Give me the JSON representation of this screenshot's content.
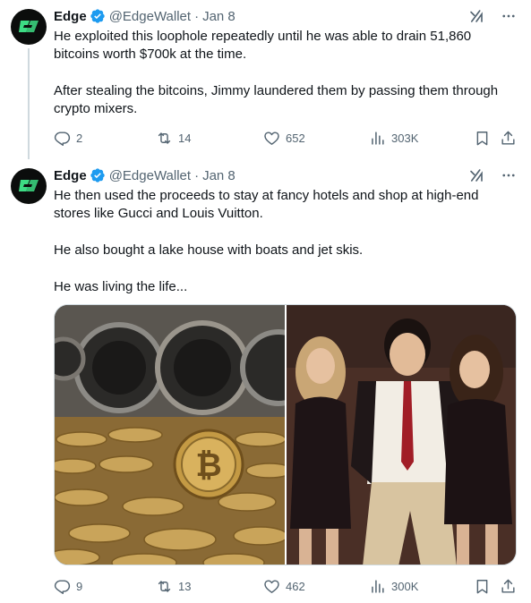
{
  "tweets": [
    {
      "author": {
        "name": "Edge",
        "handle": "@EdgeWallet",
        "date": "Jan 8"
      },
      "paragraphs": [
        "He exploited this loophole repeatedly until he was able to drain 51,860 bitcoins worth $700k at the time.",
        "After stealing the bitcoins, Jimmy laundered them by passing them through crypto mixers."
      ],
      "stats": {
        "replies": "2",
        "reposts": "14",
        "likes": "652",
        "views": "303K"
      }
    },
    {
      "author": {
        "name": "Edge",
        "handle": "@EdgeWallet",
        "date": "Jan 8"
      },
      "paragraphs": [
        "He then used the proceeds to stay at fancy hotels and shop at high-end stores like Gucci and Louis Vuitton.",
        "He also bought a lake house with boats and jet skis.",
        "He was living the life..."
      ],
      "stats": {
        "replies": "9",
        "reposts": "13",
        "likes": "462",
        "views": "300K"
      },
      "media": [
        "bitcoin-coins-washing-machines-photo",
        "group-photo-three-people"
      ]
    }
  ],
  "colors": {
    "text": "#0f1419",
    "secondary": "#536471",
    "verified": "#1d9bf0",
    "brand_green": "#3ddc84",
    "divider": "#cfd9de"
  }
}
